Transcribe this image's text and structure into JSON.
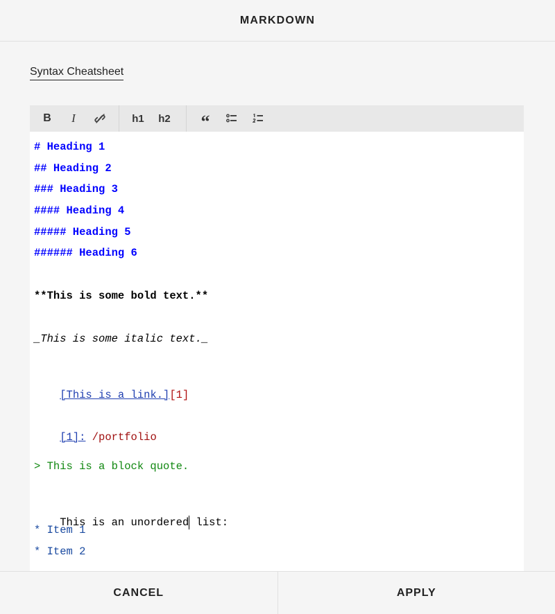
{
  "header": {
    "title": "MARKDOWN"
  },
  "tab": {
    "label": "Syntax Cheatsheet"
  },
  "toolbar": {
    "bold": "B",
    "italic": "I",
    "h1": "h1",
    "h2": "h2",
    "quote": "“"
  },
  "editor": {
    "h1": "# Heading 1",
    "h2": "## Heading 2",
    "h3": "### Heading 3",
    "h4": "#### Heading 4",
    "h5": "##### Heading 5",
    "h6": "###### Heading 6",
    "bold": "**This is some bold text.**",
    "italic": "_This is some italic text._",
    "link_text": "[This is a link.]",
    "link_ref": "[1]",
    "ref_label": "[1]:",
    "ref_url": " /portfolio",
    "quote": "> This is a block quote.",
    "list_intro_a": "This is an unordered",
    "list_intro_b": " list:",
    "item1": "* Item 1",
    "item2": "* Item 2"
  },
  "footer": {
    "cancel": "CANCEL",
    "apply": "APPLY"
  }
}
